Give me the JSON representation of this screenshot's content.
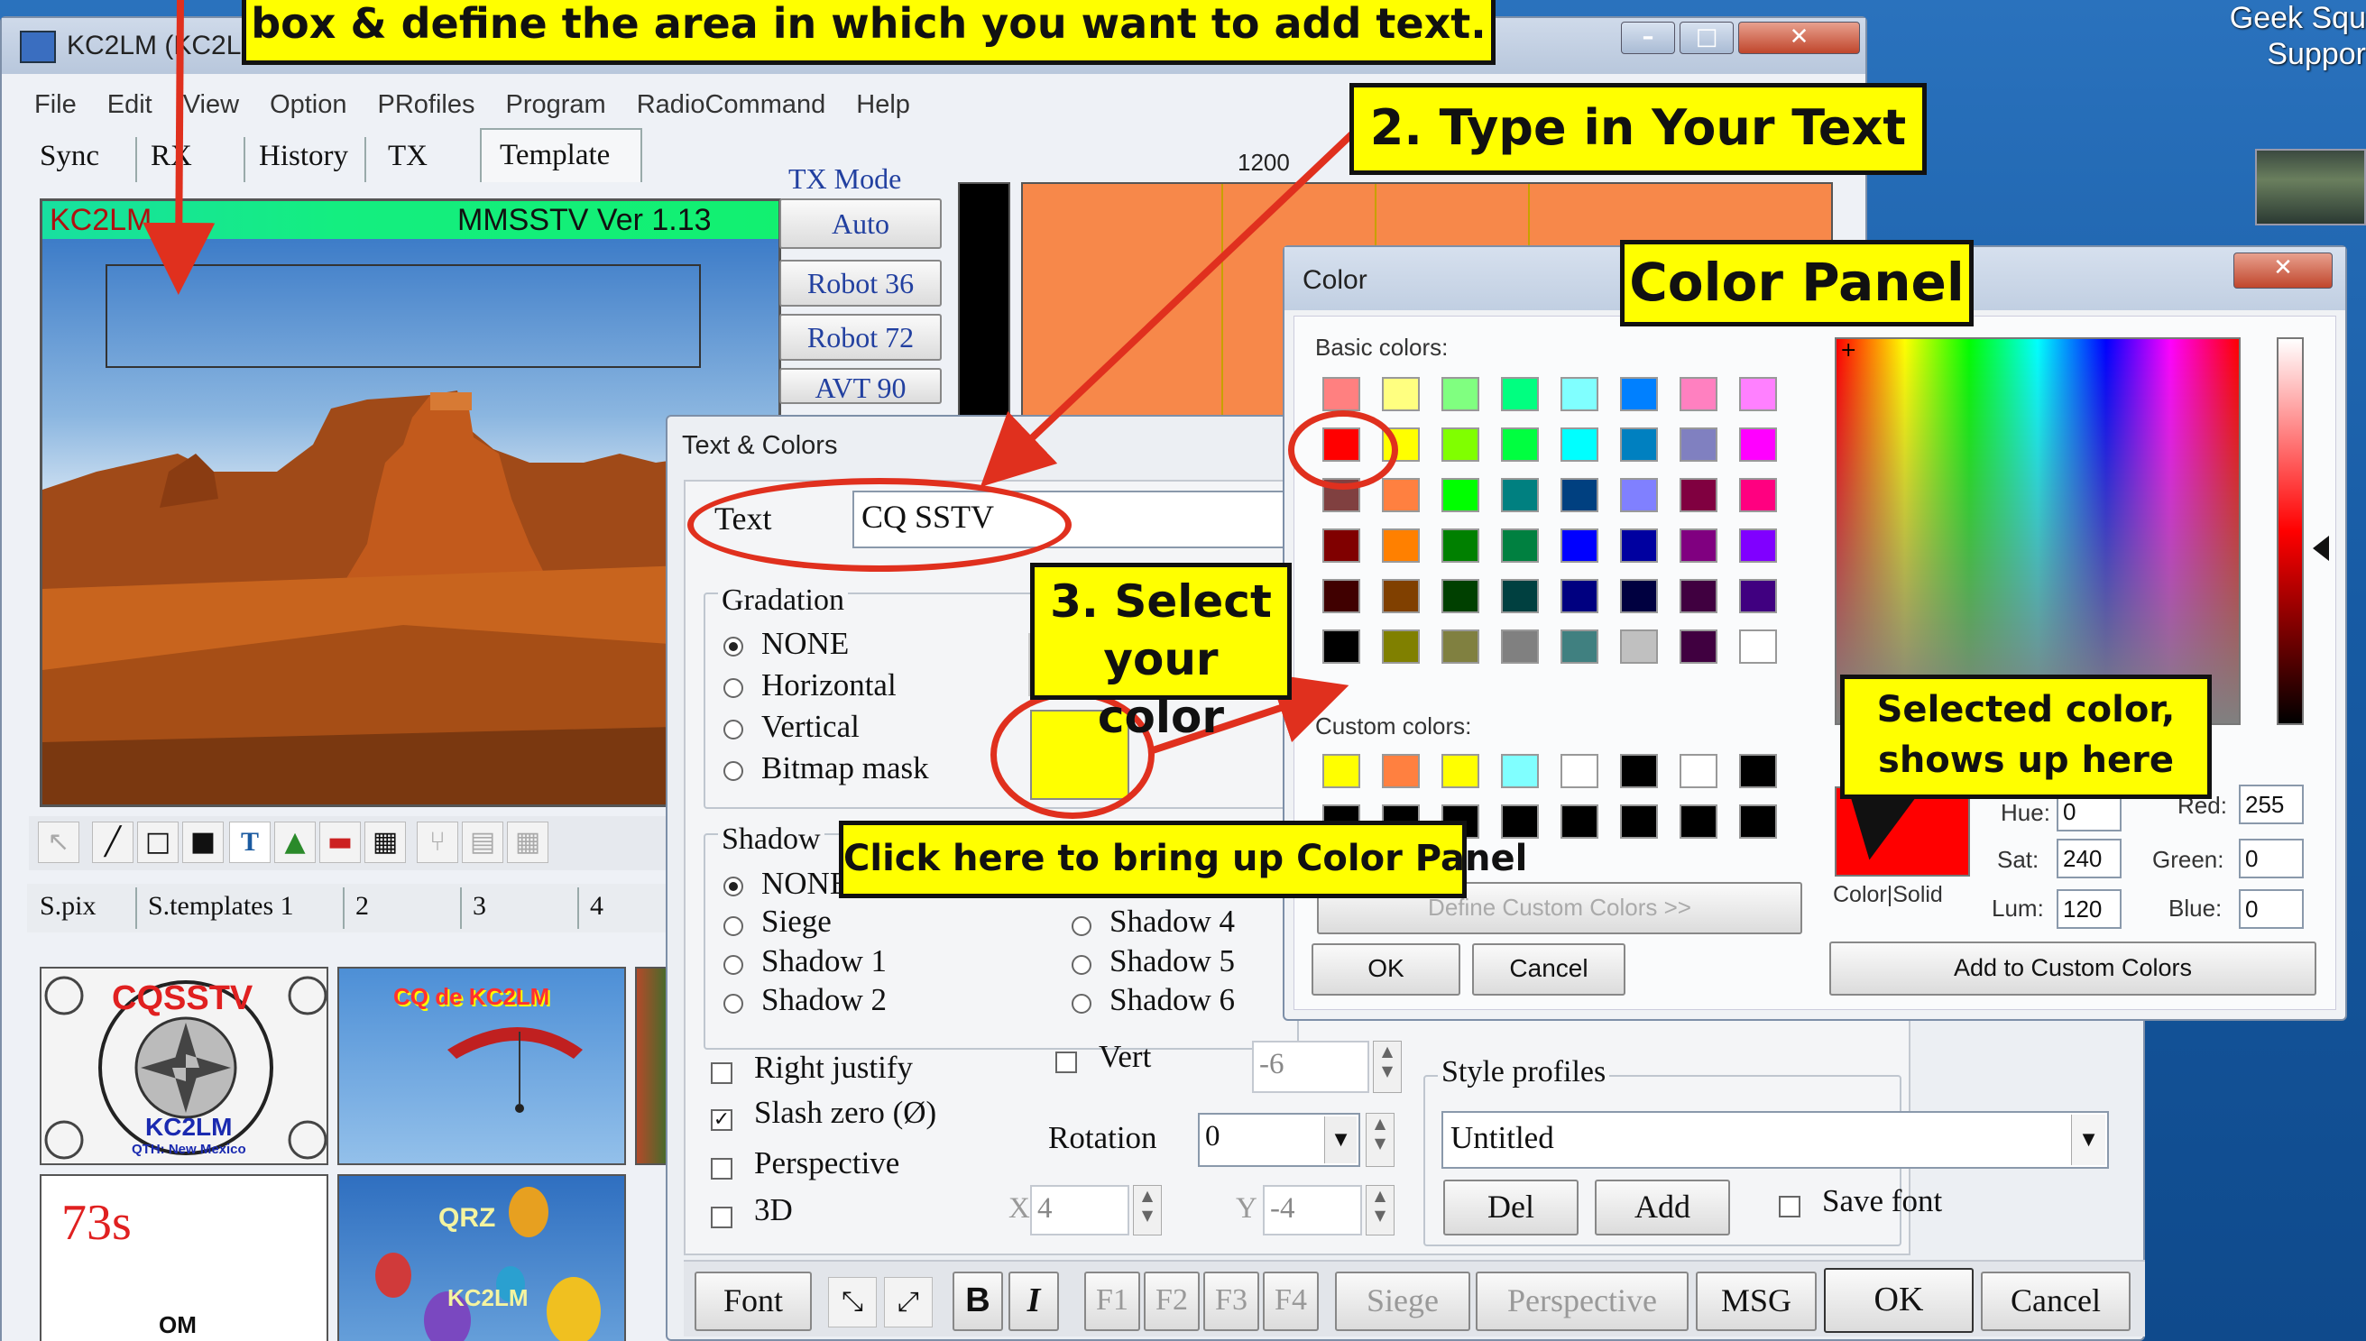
{
  "desktop": {
    "corner_text_1": "Geek Squ",
    "corner_text_2": "Suppor"
  },
  "main_window": {
    "title": "KC2LM (KC2LM",
    "menu": [
      "File",
      "Edit",
      "View",
      "Option",
      "PRofiles",
      "Program",
      "RadioCommand",
      "Help"
    ],
    "tabs": [
      "Sync",
      "RX",
      "History",
      "TX",
      "Template"
    ],
    "active_tab": "Template",
    "canvas_header_left": "KC2LM",
    "canvas_header_right": "MMSSTV Ver 1.13",
    "tx_mode_label": "TX Mode",
    "tx_modes": [
      "Auto",
      "Robot 36",
      "Robot 72",
      "AVT 90"
    ],
    "freq_label": "1200",
    "bottom_tabs": [
      "S.pix",
      "S.templates 1",
      "2",
      "3",
      "4"
    ],
    "thumb_texts": {
      "t1_top": "CQSSTV",
      "t1_bottom": "KC2LM",
      "t1_qth": "QTH: New Mexico",
      "t2": "CQ de KC2LM",
      "t3": "73s",
      "t3_bottom": "OM",
      "t4": "QRZ",
      "t4_bottom": "KC2LM"
    }
  },
  "text_colors_dialog": {
    "title": "Text & Colors",
    "text_label": "Text",
    "text_value": "CQ SSTV",
    "gradation_label": "Gradation",
    "gradation_options": [
      "NONE",
      "Horizontal",
      "Vertical",
      "Bitmap mask"
    ],
    "gradation_selected": "NONE",
    "shadow_label": "Shadow",
    "shadow_options_left": [
      "NONE",
      "Siege",
      "Shadow 1",
      "Shadow 2"
    ],
    "shadow_options_right": [
      "Shadow 4",
      "Shadow 5",
      "Shadow 6"
    ],
    "color_preview": "#ffff00",
    "right_justify": "Right justify",
    "slash_zero": "Slash zero (Ø)",
    "perspective": "Perspective",
    "three_d": "3D",
    "vert": "Vert",
    "vert_value": "-6",
    "rotation_label": "Rotation",
    "rotation_value": "0",
    "x_label": "X",
    "x_value": "4",
    "y_label": "Y",
    "y_value": "-4",
    "style_profiles_label": "Style profiles",
    "style_profile_value": "Untitled",
    "del": "Del",
    "add": "Add",
    "save_font": "Save font",
    "bottom_buttons": [
      "Font",
      "B",
      "I",
      "F1",
      "F2",
      "F3",
      "F4",
      "Siege",
      "Perspective",
      "MSG",
      "OK",
      "Cancel"
    ]
  },
  "color_dialog": {
    "title": "Color",
    "basic_colors_label": "Basic colors:",
    "basic_colors": [
      [
        "#ff8080",
        "#ffff80",
        "#80ff80",
        "#00ff80",
        "#80ffff",
        "#0080ff",
        "#ff80c0",
        "#ff80ff"
      ],
      [
        "#ff0000",
        "#ffff00",
        "#80ff00",
        "#00ff40",
        "#00ffff",
        "#0080c0",
        "#8080c0",
        "#ff00ff"
      ],
      [
        "#804040",
        "#ff8040",
        "#00ff00",
        "#008080",
        "#004080",
        "#8080ff",
        "#800040",
        "#ff0080"
      ],
      [
        "#800000",
        "#ff8000",
        "#008000",
        "#008040",
        "#0000ff",
        "#0000a0",
        "#800080",
        "#8000ff"
      ],
      [
        "#400000",
        "#804000",
        "#004000",
        "#004040",
        "#000080",
        "#000040",
        "#400040",
        "#400080"
      ],
      [
        "#000000",
        "#808000",
        "#808040",
        "#808080",
        "#408080",
        "#c0c0c0",
        "#400040",
        "#ffffff"
      ]
    ],
    "custom_colors_label": "Custom colors:",
    "custom_colors": [
      [
        "#ffff00",
        "#ff8040",
        "#ffff00",
        "#80ffff",
        "#ffffff",
        "#000000",
        "#ffffff",
        "#000000"
      ],
      [
        "#000000",
        "#000000",
        "#000000",
        "#000000",
        "#000000",
        "#000000",
        "#000000",
        "#000000"
      ]
    ],
    "define_custom": "Define Custom Colors >>",
    "ok": "OK",
    "cancel": "Cancel",
    "color_solid": "Color|Solid",
    "hue_label": "Hue:",
    "hue_value": "0",
    "sat_label": "Sat:",
    "sat_value": "240",
    "lum_label": "Lum:",
    "lum_value": "120",
    "red_label": "Red:",
    "red_value": "255",
    "green_label": "Green:",
    "green_value": "0",
    "blue_label": "Blue:",
    "blue_value": "0",
    "add_custom": "Add to Custom Colors",
    "selected_color": "#ff0000"
  },
  "annotations": {
    "step1": "box & define the area in which you want to add text.",
    "step2": "2. Type in Your Text",
    "color_panel": "Color Panel",
    "step3": "3. Select your color",
    "selected_shows": "Selected color, shows up here",
    "click_here": "Click here to bring up Color Panel"
  },
  "colors": {
    "annotation_yellow": "#ffff00",
    "arrow_red": "#e0301e",
    "desktop_blue": "#1c5fa8"
  }
}
